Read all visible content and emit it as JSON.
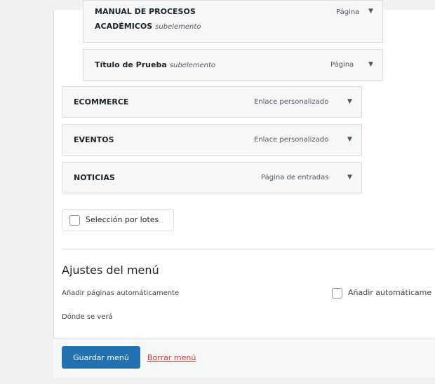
{
  "menu_items": [
    {
      "title_line1": "MANUAL DE PROCESOS",
      "title_line2": "ACADÉMICOS",
      "sub": "subelemento",
      "type": "Página"
    },
    {
      "title": "Título de Prueba",
      "sub": "subelemento",
      "type": "Página"
    },
    {
      "title": "ECOMMERCE",
      "type": "Enlace personalizado"
    },
    {
      "title": "EVENTOS",
      "type": "Enlace personalizado"
    },
    {
      "title": "NOTICIAS",
      "type": "Página de entradas"
    }
  ],
  "arrow_glyph": "▼",
  "bulk_select": {
    "label": "Selección por lotes",
    "checked": false
  },
  "menu_settings": {
    "heading": "Ajustes del menú",
    "auto_add_label": "Añadir páginas automáticamente",
    "auto_add_checkbox_label": "Añadir automáticame",
    "location_label": "Dónde se verá"
  },
  "footer": {
    "save_label": "Guardar menú",
    "delete_label": "Borrar menú"
  },
  "colors": {
    "primary": "#2271b1",
    "danger": "#d63638"
  }
}
